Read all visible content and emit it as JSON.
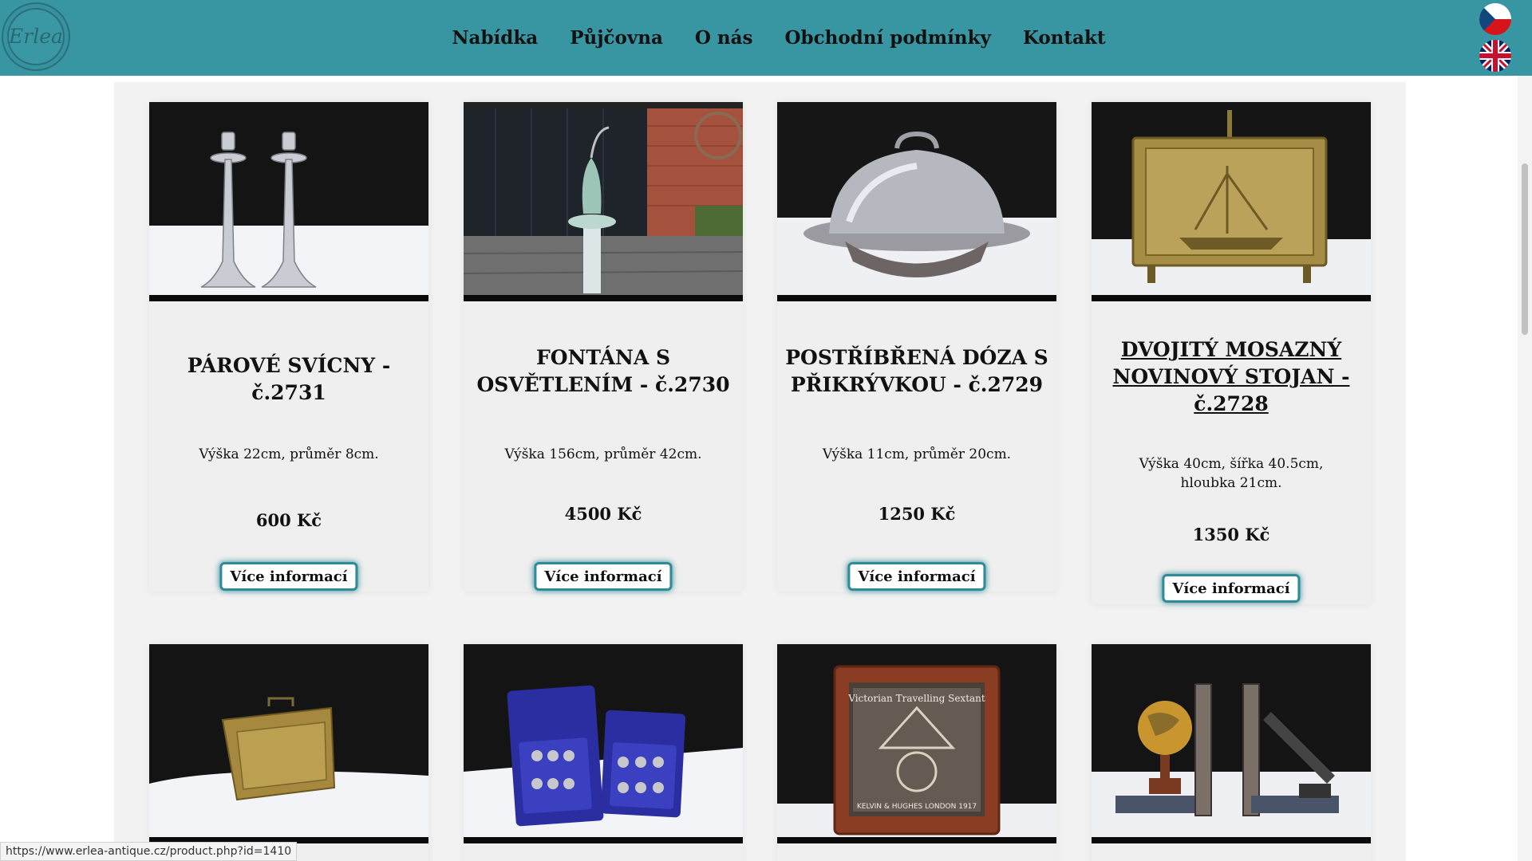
{
  "brand": {
    "logo_text": "Erlea"
  },
  "nav": {
    "items": [
      "Nabídka",
      "Půjčovna",
      "O nás",
      "Obchodní podmínky",
      "Kontakt"
    ]
  },
  "languages": [
    "cz-flag",
    "uk-flag"
  ],
  "products": [
    {
      "title": "PÁROVÉ SVÍCNY - č.2731",
      "desc": "Výška 22cm, průměr 8cm.",
      "price": "600 Kč",
      "button": "Více informací",
      "image": "candlesticks"
    },
    {
      "title": "FONTÁNA S OSVĚTLENÍM - č.2730",
      "desc": "Výška 156cm, průměr 42cm.",
      "price": "4500 Kč",
      "button": "Více informací",
      "image": "fountain"
    },
    {
      "title": "POSTŘÍBŘENÁ DÓZA S PŘIKRÝVKOU - č.2729",
      "desc": "Výška 11cm, průměr 20cm.",
      "price": "1250 Kč",
      "button": "Více informací",
      "image": "silver-dome"
    },
    {
      "title": "DVOJITÝ MOSAZNÝ NOVINOVÝ STOJAN - č.2728",
      "desc": "Výška 40cm, šířka 40.5cm, hloubka 21cm.",
      "price": "1350 Kč",
      "button": "Více informací",
      "image": "brass-rack"
    },
    {
      "image": "brass-box"
    },
    {
      "image": "goblet-set"
    },
    {
      "image": "sextant-case"
    },
    {
      "image": "globe-bookends"
    }
  ],
  "sextant_text": {
    "top": "Victorian Travelling Sextant",
    "bottom": "KELVIN & HUGHES LONDON 1917"
  },
  "status_url": "https://www.erlea-antique.cz/product.php?id=1410",
  "colors": {
    "header": "#3896a3",
    "button_border": "#2f8b97",
    "panel": "#f2f2f2"
  }
}
